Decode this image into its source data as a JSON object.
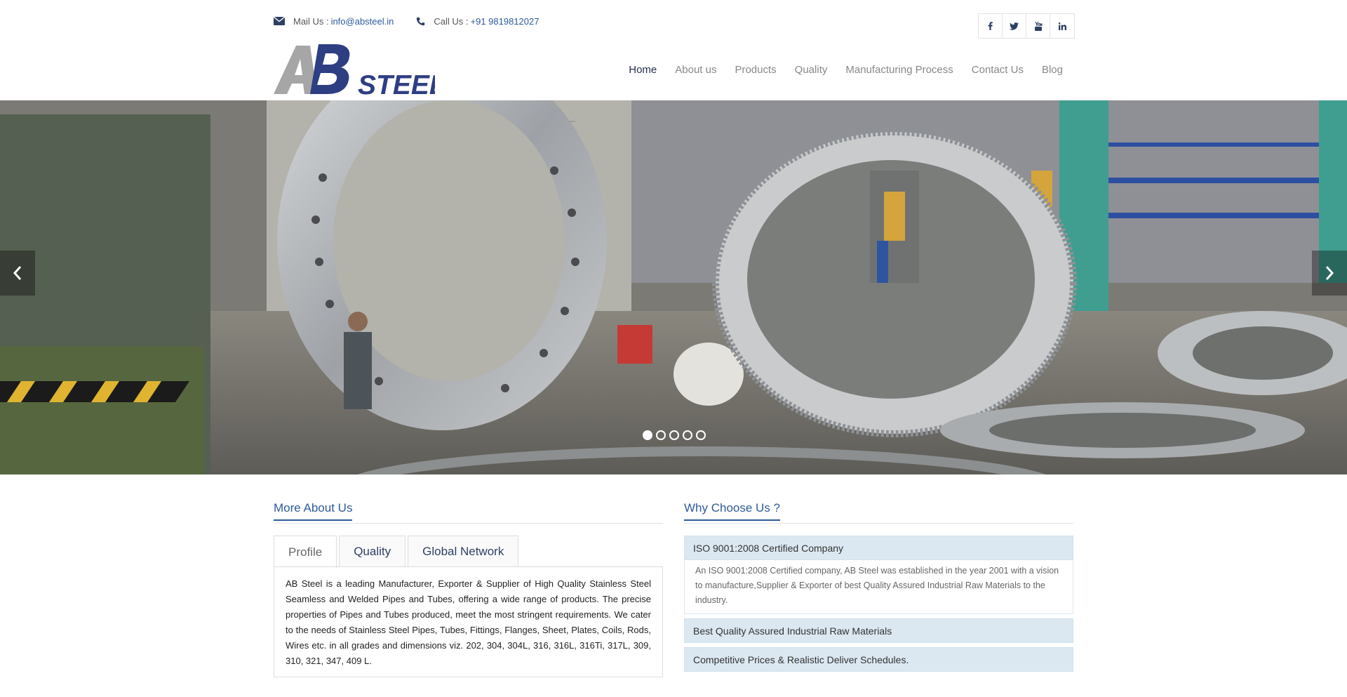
{
  "contact": {
    "mail_label": "Mail Us :",
    "mail_value": "info@absteel.in",
    "call_label": "Call Us :",
    "call_value": "+91 9819812027"
  },
  "social": [
    "facebook-icon",
    "twitter-icon",
    "youtube-icon",
    "linkedin-icon"
  ],
  "logo": {
    "text_ab": "AB",
    "text_steel": "STEEL"
  },
  "nav": {
    "items": [
      "Home",
      "About us",
      "Products",
      "Quality",
      "Manufacturing Process",
      "Contact Us",
      "Blog"
    ],
    "active": "Home"
  },
  "slider": {
    "slide_count": 5,
    "active_slide": 1
  },
  "about": {
    "heading": "More About Us",
    "tabs": [
      "Profile",
      "Quality",
      "Global Network"
    ],
    "active_tab": "Profile",
    "profile_text": "AB Steel is a leading Manufacturer, Exporter & Supplier of High Quality Stainless Steel Seamless and Welded Pipes and Tubes, offering a wide range of products. The precise properties of Pipes and Tubes produced, meet the most stringent requirements. We cater to the needs of Stainless Steel Pipes, Tubes, Fittings, Flanges, Sheet, Plates, Coils, Rods, Wires etc. in all grades and dimensions viz. 202, 304, 304L, 316, 316L, 316Ti, 317L, 309, 310, 321, 347, 409 L."
  },
  "why": {
    "heading": "Why Choose Us ?",
    "items": [
      {
        "title": "ISO 9001:2008 Certified Company",
        "body": "An ISO 9001:2008 Certified company, AB Steel was established in the year 2001 with a vision to manufacture,Supplier & Exporter of best Quality Assured Industrial Raw Materials to the industry."
      },
      {
        "title": "Best Quality Assured Industrial Raw Materials"
      },
      {
        "title": "Competitive Prices & Realistic Deliver Schedules."
      }
    ]
  },
  "colors": {
    "accent": "#2d5b9b",
    "accordion_bg": "#dbe8f1",
    "nav_active": "#1f2d4a"
  }
}
